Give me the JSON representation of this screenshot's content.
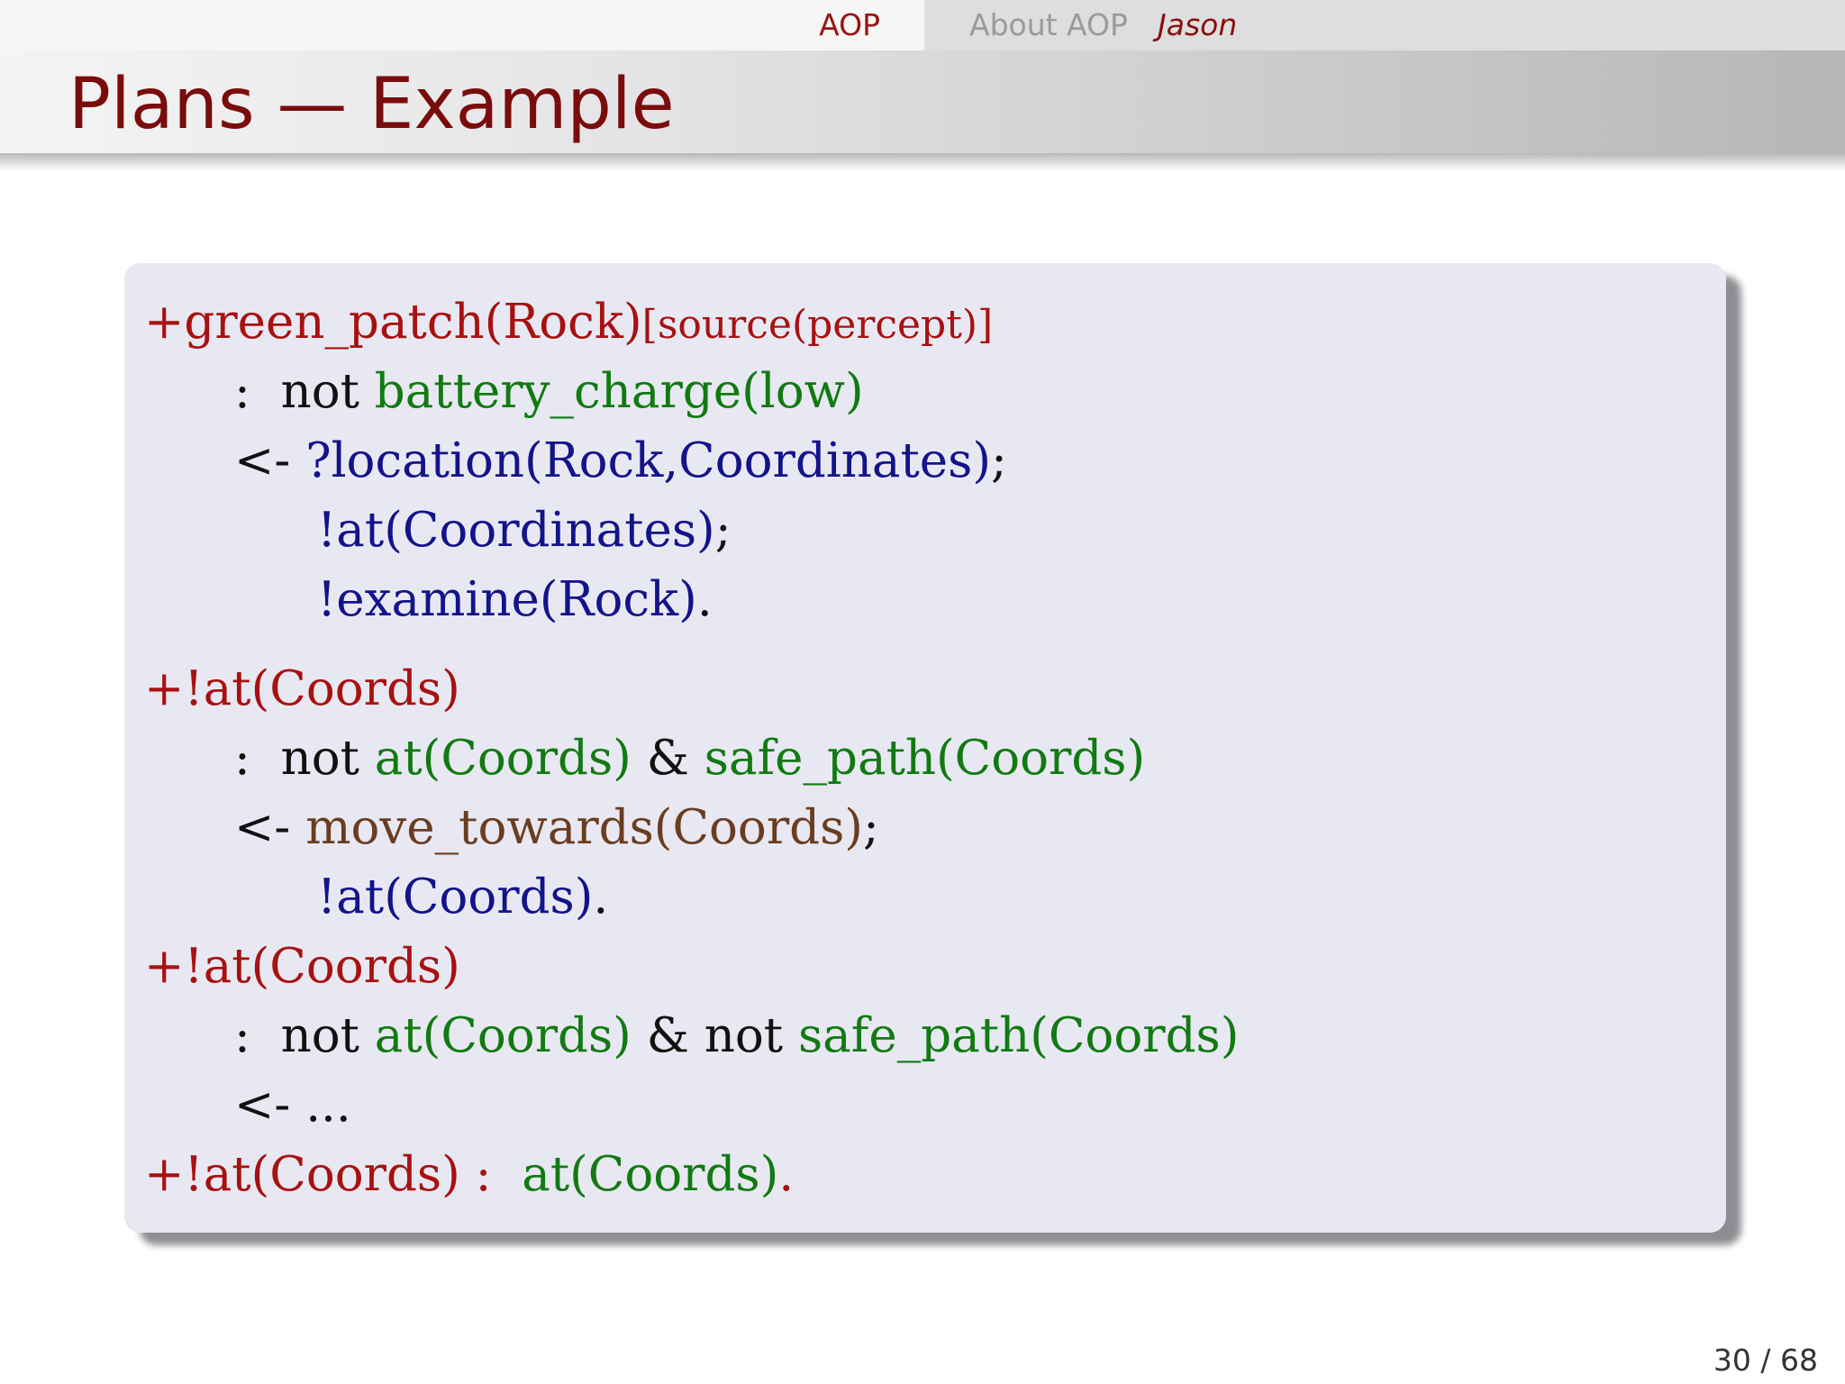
{
  "colors": {
    "keyword_red": "#a81111",
    "belief_green": "#117a11",
    "goal_blue": "#13138a",
    "action_brown": "#6a3d1f",
    "title_red": "#7a0c0c"
  },
  "nav": {
    "section": "AOP",
    "subsection": "About AOP",
    "current": "Jason"
  },
  "slide": {
    "title": "Plans — Example",
    "page_current": "30",
    "page_separator": " / ",
    "page_total": "68"
  },
  "code": {
    "p1_trigger": "+green_patch(Rock)",
    "p1_annotation": "[source(percept)]",
    "p1_context_sep": ":",
    "p1_context_not": "not",
    "p1_context_belief": "battery_charge(low)",
    "p1_body_arrow": "<-",
    "p1_body_test": "?location(Rock,Coordinates)",
    "p1_body_semicolon1": ";",
    "p1_body_goal1": "!at(Coordinates)",
    "p1_body_semicolon2": ";",
    "p1_body_goal2": "!examine(Rock)",
    "p1_body_end": ".",
    "p2_trigger": "+!at(Coords)",
    "p2_context_sep": ":",
    "p2_context_not": "not",
    "p2_context_belief1": "at(Coords)",
    "p2_context_and": "&",
    "p2_context_belief2": "safe_path(Coords)",
    "p2_body_arrow": "<-",
    "p2_body_action": "move_towards(Coords)",
    "p2_body_semicolon": ";",
    "p2_body_goal": "!at(Coords)",
    "p2_body_end": ".",
    "p3_trigger": "+!at(Coords)",
    "p3_context_sep": ":",
    "p3_context_not1": "not",
    "p3_context_belief1": "at(Coords)",
    "p3_context_and": "&",
    "p3_context_not2": "not",
    "p3_context_belief2": "safe_path(Coords)",
    "p3_body_arrow": "<-",
    "p3_body_ellipsis": "...",
    "p4_trigger": "+!at(Coords)",
    "p4_context_sep": ":",
    "p4_context_belief": "at(Coords)",
    "p4_end": "."
  }
}
